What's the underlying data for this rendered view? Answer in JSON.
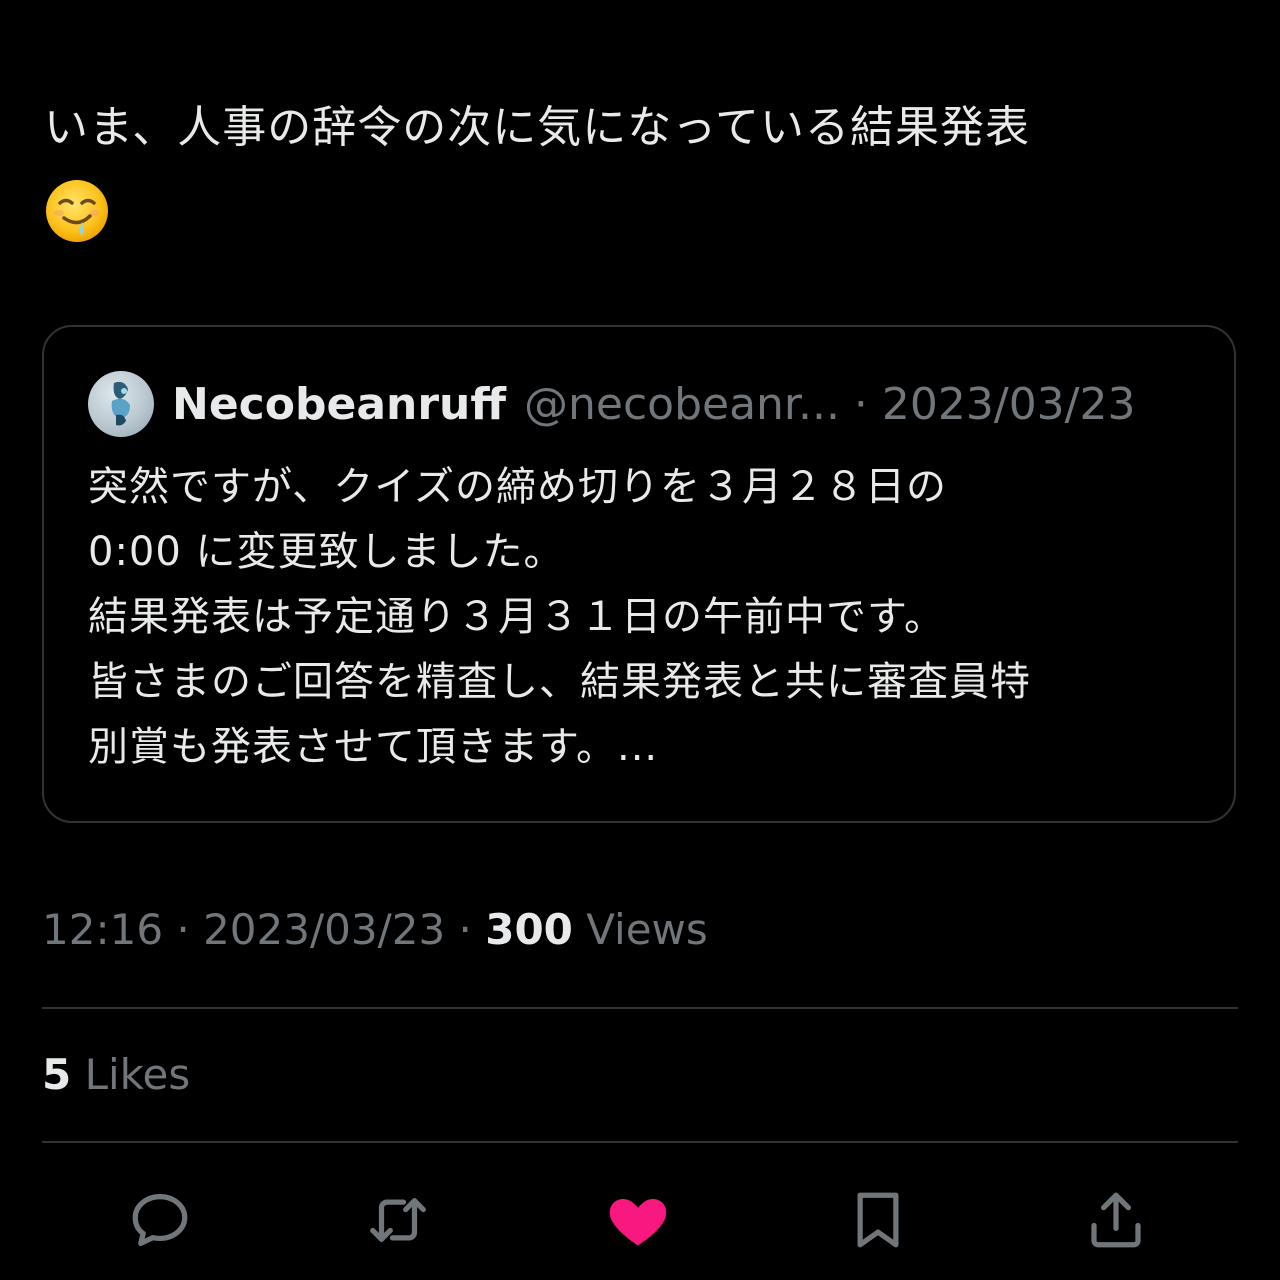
{
  "tweet": {
    "text_line1": "いま、人事の辞令の次に気になっている結果発表",
    "emoji": "drooling-face-emoji"
  },
  "quote": {
    "name": "Necobeanruff",
    "meta": "@necobeanr... · 2023/03/23",
    "lines": [
      "突然ですが、クイズの締め切りを３月２８日の",
      "0:00 に変更致しました。",
      "結果発表は予定通り３月３１日の午前中です。",
      "皆さまのご回答を精査し、結果発表と共に審査員特",
      "別賞も発表させて頂きます。..."
    ]
  },
  "stats": {
    "time_date": "12:16 · 2023/03/23 · ",
    "views_count": "300",
    "views_label": " Views",
    "likes_count": "5",
    "likes_label": " Likes"
  },
  "actions": {
    "reply_icon": "reply-icon",
    "retweet_icon": "retweet-icon",
    "like_icon": "heart-icon",
    "bookmark_icon": "bookmark-icon",
    "share_icon": "share-icon"
  },
  "colors": {
    "background": "#000000",
    "text": "#e7e9ea",
    "muted": "#71767b",
    "border": "#2f3336",
    "like": "#f91880"
  }
}
